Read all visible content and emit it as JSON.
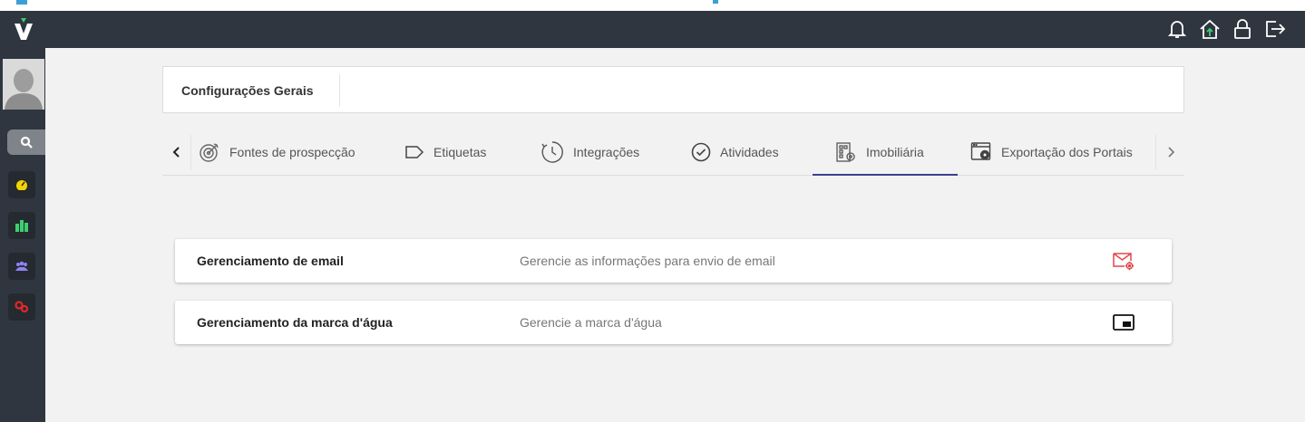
{
  "header": {
    "title": "Configurações Gerais"
  },
  "tabs": [
    {
      "label": "Fontes de prospecção",
      "icon": "target-icon"
    },
    {
      "label": "Etiquetas",
      "icon": "tag-icon"
    },
    {
      "label": "Integrações",
      "icon": "clock-sync-icon"
    },
    {
      "label": "Atividades",
      "icon": "check-circle-icon"
    },
    {
      "label": "Imobiliária",
      "icon": "building-gear-icon",
      "active": true
    },
    {
      "label": "Exportação dos Portais",
      "icon": "window-gear-icon"
    }
  ],
  "cards": [
    {
      "title": "Gerenciamento de email",
      "description": "Gerencie as informações para envio de email",
      "icon": "email-gear-icon"
    },
    {
      "title": "Gerenciamento da marca d'água",
      "description": "Gerencie a marca d'água",
      "icon": "watermark-icon"
    }
  ],
  "colors": {
    "topbar": "#2f3640",
    "accent_green": "#3cd070",
    "active_tab": "#3b3f8f",
    "email_icon": "#e0474c"
  }
}
